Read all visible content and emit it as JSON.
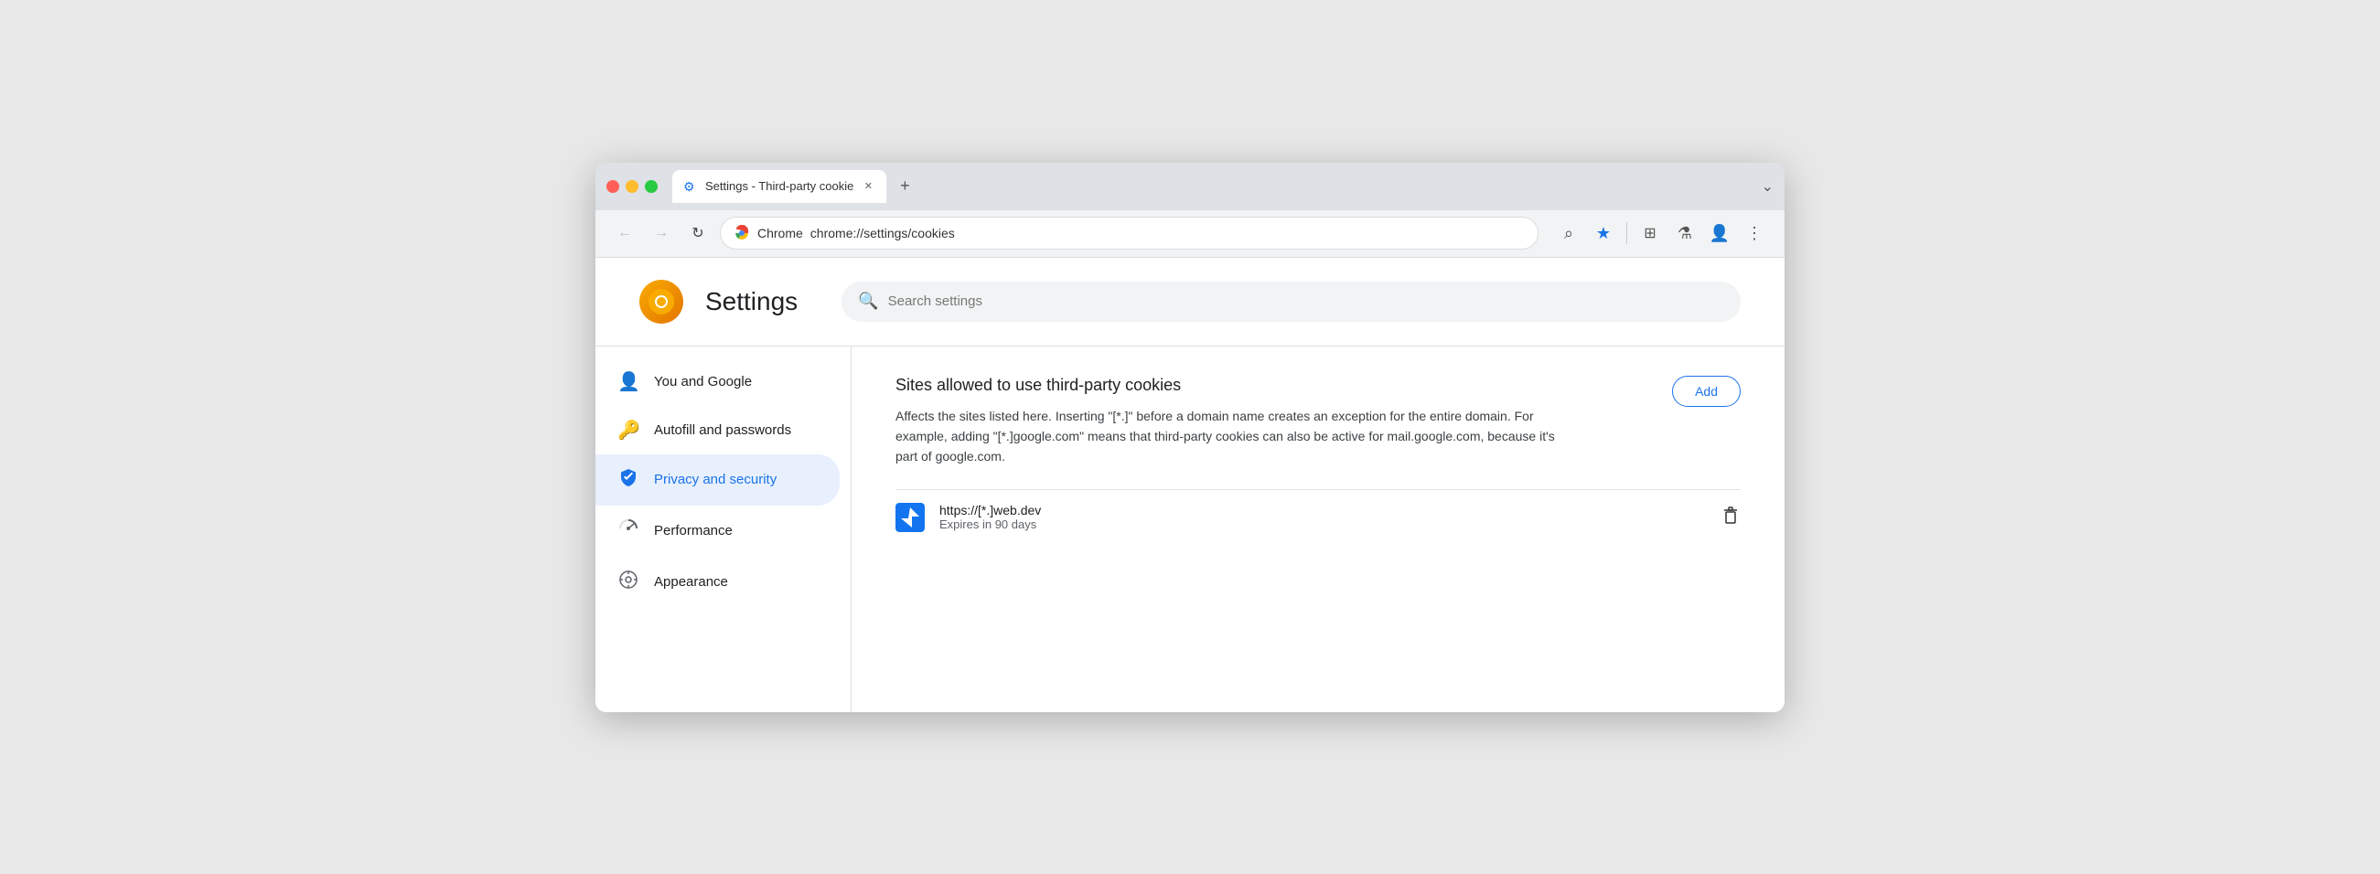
{
  "browser": {
    "tab_title": "Settings - Third-party cookie",
    "tab_favicon": "⚙",
    "new_tab_icon": "+",
    "window_controls_icon": "⌄",
    "back_icon": "←",
    "forward_icon": "→",
    "reload_icon": "↻",
    "chrome_label": "Chrome",
    "address_url": "chrome://settings/cookies",
    "zoom_icon": "⌕",
    "bookmark_icon": "★",
    "extensions_icon": "⧉",
    "lab_icon": "⚗",
    "profile_icon": "👤",
    "menu_icon": "⋮"
  },
  "settings": {
    "logo_icon": "●",
    "title": "Settings",
    "search_placeholder": "Search settings"
  },
  "sidebar": {
    "items": [
      {
        "id": "you-and-google",
        "label": "You and Google",
        "icon": "👤"
      },
      {
        "id": "autofill",
        "label": "Autofill and passwords",
        "icon": "🔑"
      },
      {
        "id": "privacy",
        "label": "Privacy and security",
        "icon": "🛡",
        "active": true
      },
      {
        "id": "performance",
        "label": "Performance",
        "icon": "◑"
      },
      {
        "id": "appearance",
        "label": "Appearance",
        "icon": "🎨"
      }
    ]
  },
  "main": {
    "section_title": "Sites allowed to use third-party cookies",
    "section_desc": "Affects the sites listed here. Inserting \"[*.]\" before a domain name creates an exception for the entire domain. For example, adding \"[*.]google.com\" means that third-party cookies can also be active for mail.google.com, because it's part of google.com.",
    "add_button_label": "Add",
    "cookie_entry": {
      "url": "https://[*.]web.dev",
      "expires": "Expires in 90 days",
      "delete_icon": "🗑"
    }
  }
}
